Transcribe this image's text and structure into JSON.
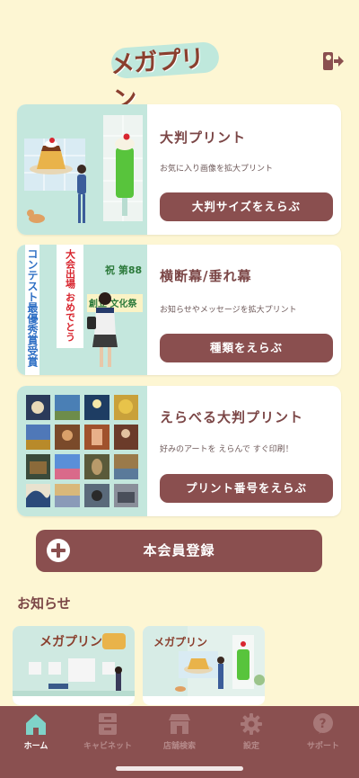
{
  "app": {
    "logo_text": "メガプリン"
  },
  "cards": [
    {
      "title": "大判プリント",
      "description": "お気に入り画像を拡大プリント",
      "button_label": "大判サイズをえらぶ"
    },
    {
      "title": "横断幕/垂れ幕",
      "description": "お知らせやメッセージを拡大プリント",
      "button_label": "種類をえらぶ"
    },
    {
      "title": "えらべる大判プリント",
      "description": "好みのアートを えらんで すぐ印刷！",
      "button_label": "プリント番号をえらぶ"
    }
  ],
  "banner_text": {
    "left": "コンテスト最優秀賞受賞",
    "middle": "大会出場 おめでとう",
    "top_right": "祝 第88",
    "right": "創立 文化祭"
  },
  "register": {
    "label": "本会員登録"
  },
  "news": {
    "title": "お知らせ",
    "items": [
      {
        "logo_text": "メガプリン"
      },
      {
        "logo_text": "メガプリン"
      }
    ]
  },
  "tabbar": {
    "items": [
      {
        "label": "ホーム",
        "icon": "home-icon",
        "active": true
      },
      {
        "label": "キャビネット",
        "icon": "cabinet-icon",
        "active": false
      },
      {
        "label": "店舗検索",
        "icon": "store-icon",
        "active": false
      },
      {
        "label": "設定",
        "icon": "gear-icon",
        "active": false
      },
      {
        "label": "サポート",
        "icon": "help-icon",
        "active": false
      }
    ]
  },
  "colors": {
    "background": "#fdf6d3",
    "accent": "#8a4f4f",
    "tabbar": "#8a5050",
    "card_image_bg": "#c4e7dd"
  }
}
